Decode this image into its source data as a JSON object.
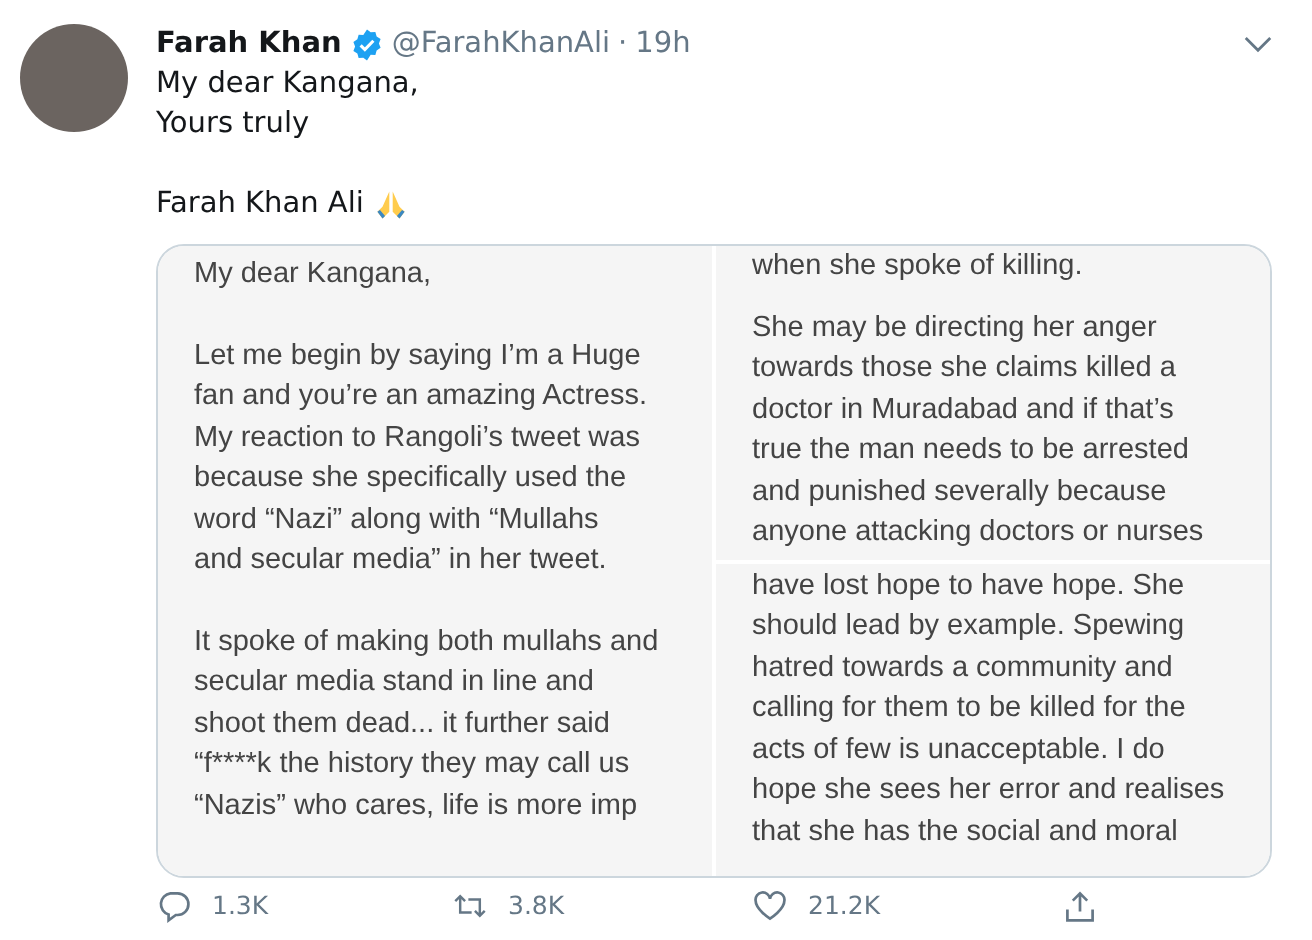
{
  "tweet": {
    "author": {
      "name": "Farah Khan",
      "handle": "@FarahKhanAli",
      "separator": "·",
      "time": "19h"
    },
    "body": [
      "My dear Kangana,",
      "Yours truly"
    ],
    "signature": "Farah Khan Ali",
    "media": [
      {
        "paragraphs": [
          [
            "My dear Kangana,"
          ],
          [
            "Let me begin by saying I’m a Huge",
            "fan and you’re an amazing Actress.",
            "My reaction to Rangoli’s tweet was",
            "because she specifically used the",
            "word “Nazi” along with “Mullahs",
            "and secular media” in her tweet."
          ],
          [
            "It spoke of making both mullahs and",
            "secular media stand in line and",
            "shoot them dead... it further said",
            "“f****k the history they may call us",
            "“Nazis” who cares, life is more imp"
          ]
        ]
      },
      {
        "paragraphs": [
          [
            "when she spoke of killing."
          ],
          [
            "She may be directing her anger",
            "towards those she claims killed a",
            "doctor in Muradabad and if that’s",
            "true the man needs to be arrested",
            "and punished severally because",
            "anyone attacking doctors or nurses"
          ]
        ]
      },
      {
        "paragraphs": [
          [
            "have lost hope to have hope. She",
            "should lead by example. Spewing",
            "hatred towards a community and",
            "calling for them to be killed for the",
            "acts of few is unacceptable. I do",
            "hope she sees her error and realises",
            "that she has the social and moral"
          ]
        ]
      }
    ],
    "actions": [
      {
        "kind": "reply",
        "count": "1.3K"
      },
      {
        "kind": "retweet",
        "count": "3.8K"
      },
      {
        "kind": "like",
        "count": "21.2K"
      },
      {
        "kind": "share"
      }
    ]
  }
}
